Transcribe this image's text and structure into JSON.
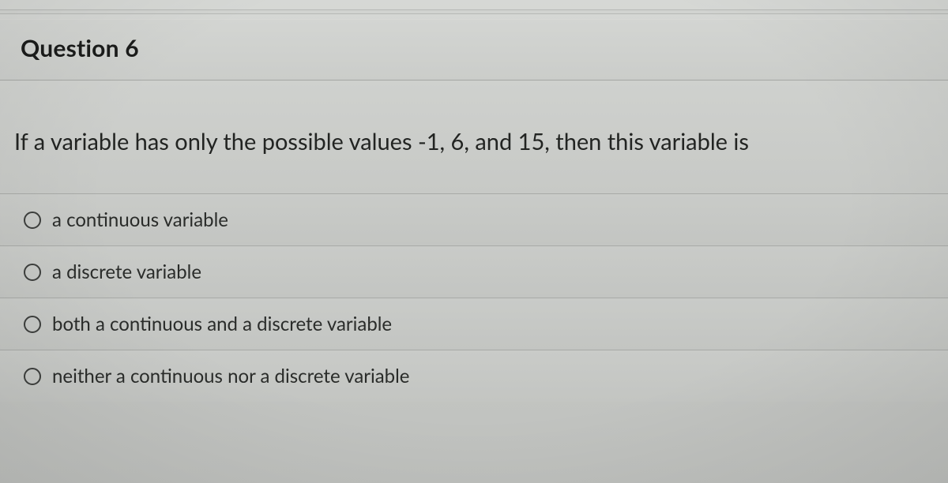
{
  "header": {
    "title": "Question 6"
  },
  "question": {
    "text": "If a variable has only the possible values -1, 6, and 15, then this variable is"
  },
  "options": [
    {
      "label": "a continuous variable",
      "selected": false
    },
    {
      "label": "a discrete variable",
      "selected": false
    },
    {
      "label": "both a continuous and a discrete variable",
      "selected": false
    },
    {
      "label": "neither a continuous nor a discrete variable",
      "selected": false
    }
  ]
}
